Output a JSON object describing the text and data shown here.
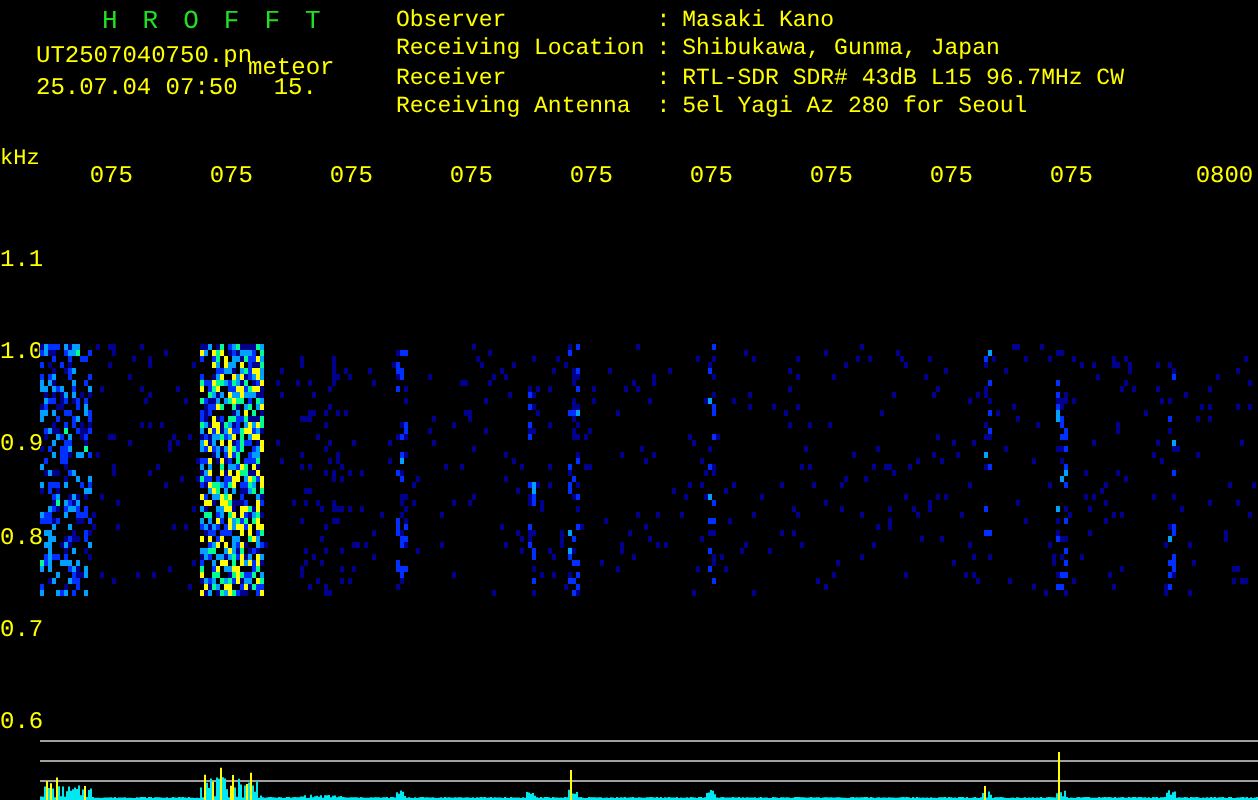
{
  "header": {
    "program": "HROFFT",
    "filename": "UT2507040750.pn",
    "tag": "meteor",
    "timestamp": "25.07.04 07:50",
    "value": "15."
  },
  "station": [
    {
      "label": "Observer",
      "separator": ":",
      "value": "Masaki Kano"
    },
    {
      "label": "Receiving Location",
      "separator": ":",
      "value": "Shibukawa, Gunma, Japan"
    },
    {
      "label": "Receiver",
      "separator": ":",
      "value": "RTL-SDR SDR# 43dB L15 96.7MHz CW"
    },
    {
      "label": "Receiving Antenna",
      "separator": ":",
      "value": "5el Yagi Az 280 for Seoul"
    }
  ],
  "frequency_unit": "kHz",
  "time_labels": [
    "075",
    "075",
    "075",
    "075",
    "075",
    "075",
    "075",
    "075",
    "075",
    "0800"
  ],
  "frequency_labels": [
    "1.1",
    "1.0",
    "0.9",
    "0.8",
    "0.7",
    "0.6"
  ]
}
